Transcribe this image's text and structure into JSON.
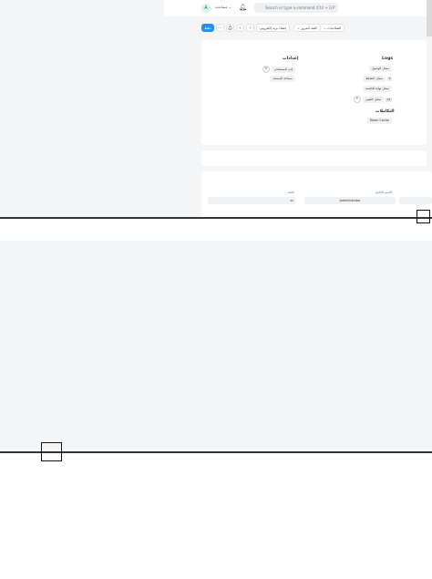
{
  "navbar": {
    "avatar_letter": "A",
    "help_label": "مساعدة",
    "search_placeholder": "Search or type a command (Ctrl + G)",
    "notification_icon": "bell-icon",
    "search_icon": "search-icon"
  },
  "toolbar": {
    "save_label": "حفظ",
    "more_icon": "ellipsis-icon",
    "print_icon": "printer-icon",
    "prev_icon": "chevron-left-icon",
    "next_icon": "chevron-right-icon",
    "email_label": "إنشاء بريد إلكتروني",
    "reset_password_label": "كلمة المرور",
    "permissions_label": "الصلاحيات"
  },
  "connections": {
    "logs_heading": "Logs",
    "settings_heading": "إعدادات",
    "config_heading": "التكاملات",
    "logs_items": [
      {
        "label": "سجل الوصول"
      },
      {
        "label": "سجل النشاط",
        "count": "4"
      },
      {
        "label": "سجل نهاية الجلسة"
      },
      {
        "label": "سجل التغيير",
        "count": "24"
      }
    ],
    "settings_items": [
      {
        "label": "إذن المستخدم"
      },
      {
        "label": "مساحة المستند"
      }
    ],
    "config_items": [
      {
        "label": "Token Cache"
      }
    ]
  },
  "form": {
    "full_name_label": "الاسم الكامل",
    "full_name_value": "Administrator",
    "language_label": "اللغة",
    "language_value": "ar"
  },
  "colors": {
    "primary": "#2490ef",
    "background": "#f4f5f6",
    "avatar_bg": "#d7f5e5"
  }
}
